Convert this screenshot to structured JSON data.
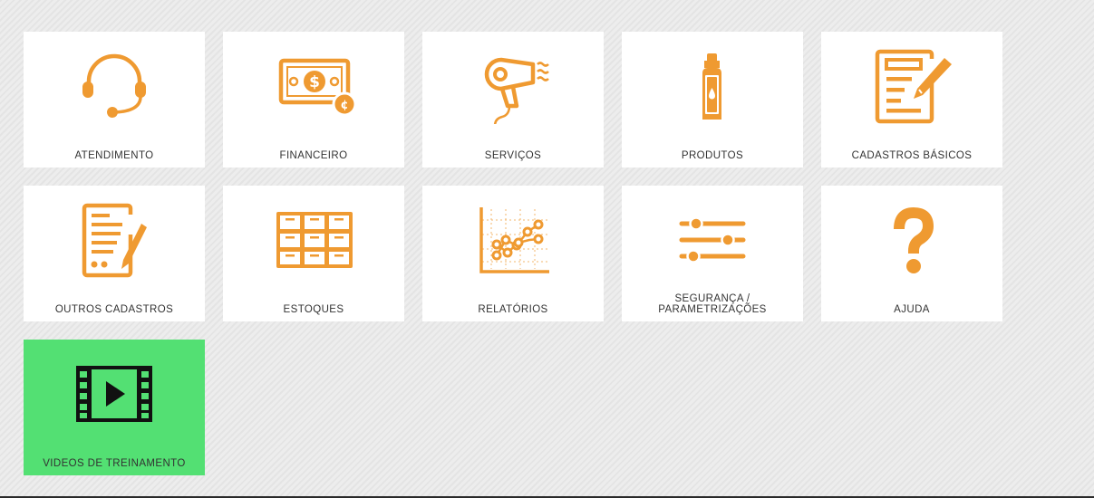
{
  "colors": {
    "accent": "#ef9a31",
    "tile_bg": "#ffffff",
    "video_tile_bg": "#53e073",
    "label_text": "#333333",
    "video_icon": "#111111"
  },
  "menu": [
    {
      "id": "atendimento",
      "label": "ATENDIMENTO",
      "icon": "headset-icon"
    },
    {
      "id": "financeiro",
      "label": "FINANCEIRO",
      "icon": "money-icon"
    },
    {
      "id": "servicos",
      "label": "SERVIÇOS",
      "icon": "hair-dryer-icon"
    },
    {
      "id": "produtos",
      "label": "PRODUTOS",
      "icon": "spray-bottle-icon"
    },
    {
      "id": "cadastros-basicos",
      "label": "CADASTROS BÁSICOS",
      "icon": "form-pencil-icon"
    },
    {
      "id": "outros-cadastros",
      "label": "OUTROS CADASTROS",
      "icon": "document-pencil-icon"
    },
    {
      "id": "estoques",
      "label": "ESTOQUES",
      "icon": "drawers-icon"
    },
    {
      "id": "relatorios",
      "label": "RELATÓRIOS",
      "icon": "line-chart-icon"
    },
    {
      "id": "seguranca",
      "label": "SEGURANÇA /\nPARAMETRIZAÇÕES",
      "icon": "sliders-icon"
    },
    {
      "id": "ajuda",
      "label": "AJUDA",
      "icon": "question-icon"
    },
    {
      "id": "videos",
      "label": "VIDEOS DE TREINAMENTO",
      "icon": "film-play-icon"
    }
  ]
}
